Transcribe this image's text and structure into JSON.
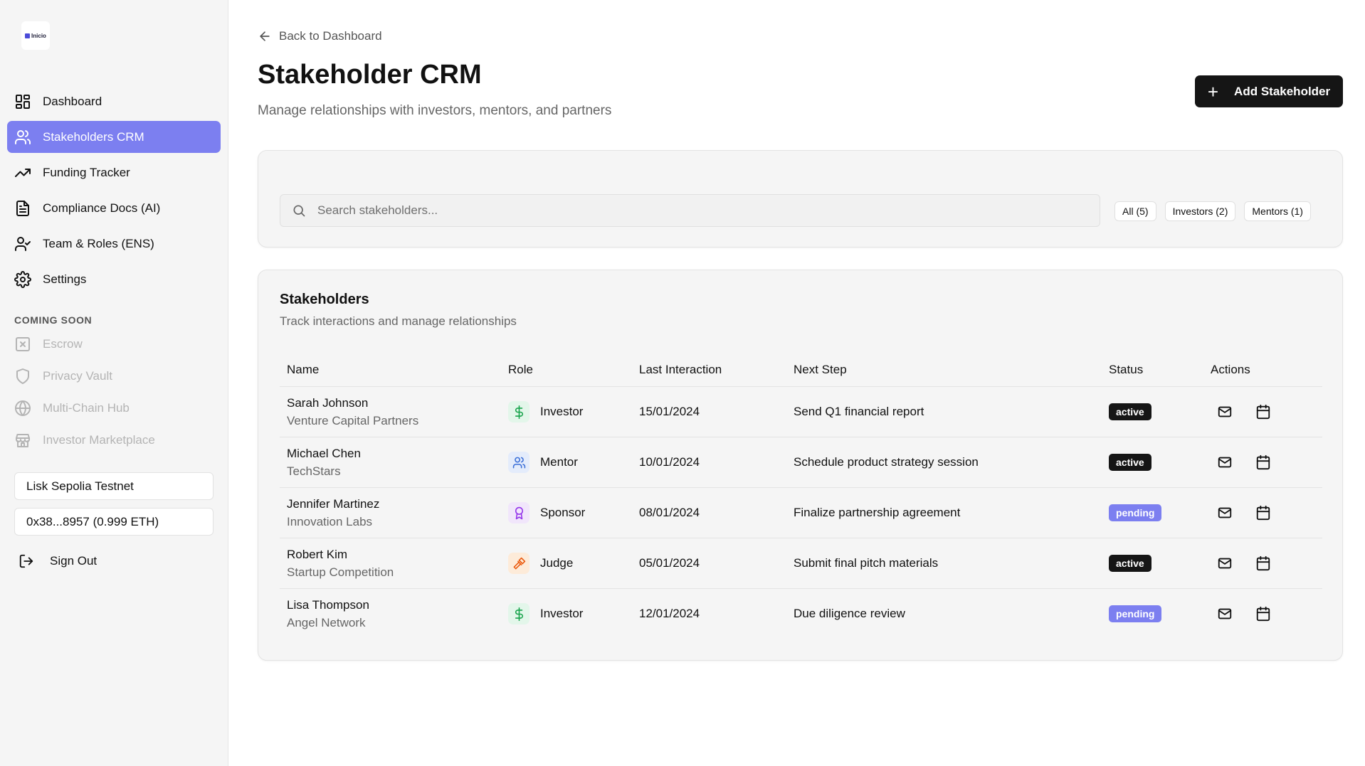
{
  "sidebar": {
    "logo_text": "Inicio",
    "nav": [
      {
        "label": "Dashboard",
        "icon": "layout-grid-icon"
      },
      {
        "label": "Stakeholders CRM",
        "icon": "users-icon",
        "active": true
      },
      {
        "label": "Funding Tracker",
        "icon": "trending-up-icon"
      },
      {
        "label": "Compliance Docs (AI)",
        "icon": "file-text-icon"
      },
      {
        "label": "Team & Roles (ENS)",
        "icon": "user-check-icon"
      },
      {
        "label": "Settings",
        "icon": "gear-icon"
      }
    ],
    "coming_soon_label": "COMING SOON",
    "coming_soon": [
      {
        "label": "Escrow",
        "icon": "x-square-icon"
      },
      {
        "label": "Privacy Vault",
        "icon": "shield-icon"
      },
      {
        "label": "Multi-Chain Hub",
        "icon": "globe-icon"
      },
      {
        "label": "Investor Marketplace",
        "icon": "store-icon"
      }
    ],
    "network": "Lisk Sepolia Testnet",
    "wallet": "0x38...8957 (0.999 ETH)",
    "sign_out": "Sign Out"
  },
  "header": {
    "back_label": "Back to Dashboard",
    "title": "Stakeholder CRM",
    "subtitle": "Manage relationships with investors, mentors, and partners",
    "add_button": "Add Stakeholder"
  },
  "search": {
    "placeholder": "Search stakeholders...",
    "filters": [
      "All (5)",
      "Investors (2)",
      "Mentors (1)"
    ]
  },
  "table": {
    "title": "Stakeholders",
    "subtitle": "Track interactions and manage relationships",
    "columns": [
      "Name",
      "Role",
      "Last Interaction",
      "Next Step",
      "Status",
      "Actions"
    ],
    "rows": [
      {
        "name": "Sarah Johnson",
        "org": "Venture Capital Partners",
        "role": "Investor",
        "role_icon": "dollar-icon",
        "last": "15/01/2024",
        "next": "Send Q1 financial report",
        "status": "active"
      },
      {
        "name": "Michael Chen",
        "org": "TechStars",
        "role": "Mentor",
        "role_icon": "users-icon",
        "last": "10/01/2024",
        "next": "Schedule product strategy session",
        "status": "active"
      },
      {
        "name": "Jennifer Martinez",
        "org": "Innovation Labs",
        "role": "Sponsor",
        "role_icon": "award-icon",
        "last": "08/01/2024",
        "next": "Finalize partnership agreement",
        "status": "pending"
      },
      {
        "name": "Robert Kim",
        "org": "Startup Competition",
        "role": "Judge",
        "role_icon": "gavel-icon",
        "last": "05/01/2024",
        "next": "Submit final pitch materials",
        "status": "active"
      },
      {
        "name": "Lisa Thompson",
        "org": "Angel Network",
        "role": "Investor",
        "role_icon": "dollar-icon",
        "last": "12/01/2024",
        "next": "Due diligence review",
        "status": "pending"
      }
    ]
  },
  "colors": {
    "accent": "#7c7ff0",
    "dark": "#151515",
    "investor_bg": "#e3f6ea",
    "investor_fg": "#16a34a",
    "mentor_bg": "#e4ecfb",
    "mentor_fg": "#3b6fd8",
    "sponsor_bg": "#f1e6fb",
    "sponsor_fg": "#9333ea",
    "judge_bg": "#fdebd9",
    "judge_fg": "#ea580c"
  }
}
